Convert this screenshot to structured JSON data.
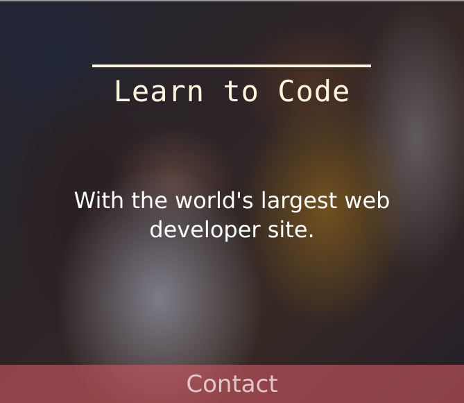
{
  "hero": {
    "title": "Learn to Code",
    "subtitle": "With the world's largest web developer site."
  },
  "footer": {
    "contact_label": "Contact"
  },
  "colors": {
    "title": "#fff6dc",
    "subtitle": "#ffffff",
    "contact_bar": "#cd555f"
  }
}
